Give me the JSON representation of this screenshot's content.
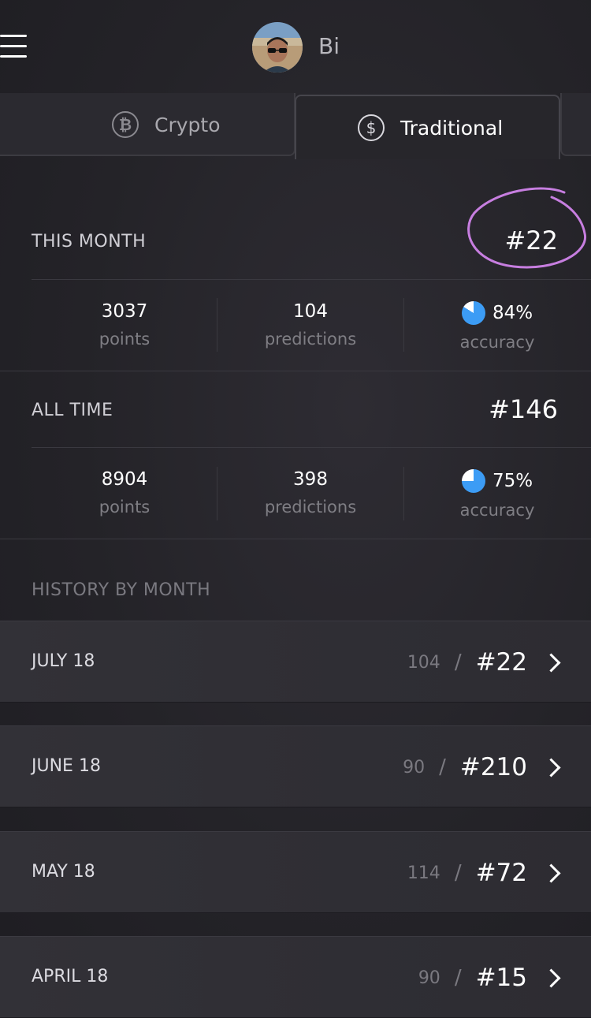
{
  "header": {
    "username": "Bi"
  },
  "tabs": [
    {
      "label": "Crypto",
      "icon": "bitcoin-icon",
      "symbol": "₿",
      "active": false
    },
    {
      "label": "Traditional",
      "icon": "dollar-icon",
      "symbol": "$",
      "active": true
    }
  ],
  "this_month": {
    "title": "THIS MONTH",
    "rank": "#22",
    "points": "3037",
    "points_label": "points",
    "predictions": "104",
    "predictions_label": "predictions",
    "accuracy": "84%",
    "accuracy_label": "accuracy",
    "accuracy_fraction": 0.84
  },
  "all_time": {
    "title": "ALL TIME",
    "rank": "#146",
    "points": "8904",
    "points_label": "points",
    "predictions": "398",
    "predictions_label": "predictions",
    "accuracy": "75%",
    "accuracy_label": "accuracy",
    "accuracy_fraction": 0.75
  },
  "history": {
    "title": "HISTORY BY MONTH",
    "months": [
      {
        "name": "JULY 18",
        "predictions": "104",
        "rank": "#22"
      },
      {
        "name": "JUNE 18",
        "predictions": "90",
        "rank": "#210"
      },
      {
        "name": "MAY 18",
        "predictions": "114",
        "rank": "#72"
      },
      {
        "name": "APRIL 18",
        "predictions": "90",
        "rank": "#15"
      }
    ]
  },
  "colors": {
    "accent": "#3c9cf5",
    "annotation": "#c77ee0"
  }
}
